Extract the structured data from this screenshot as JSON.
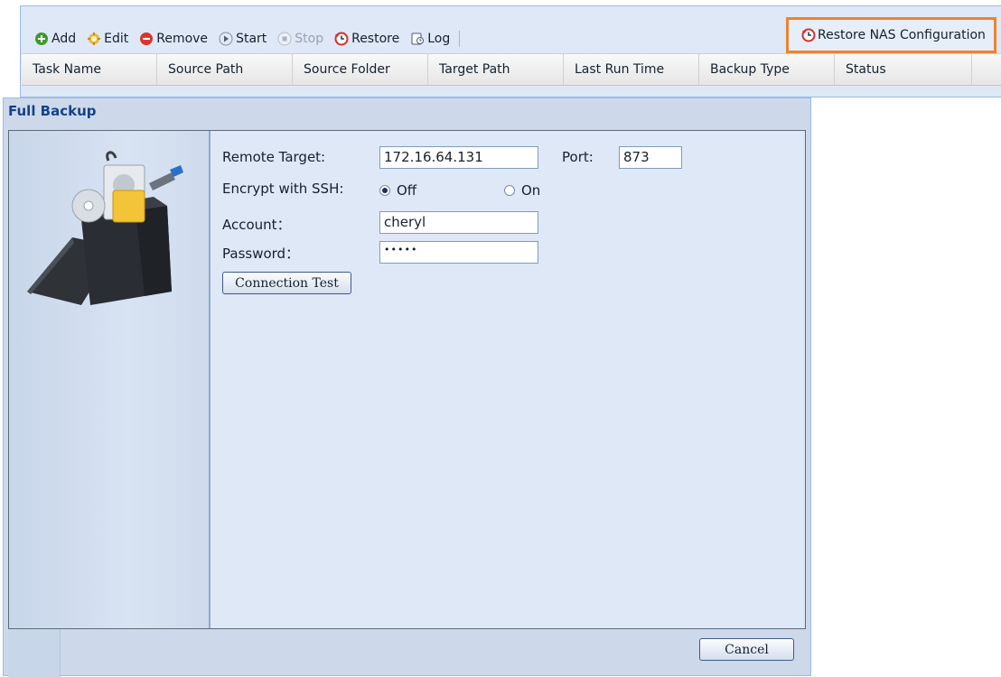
{
  "toolbar": {
    "add": "Add",
    "edit": "Edit",
    "remove": "Remove",
    "start": "Start",
    "stop": "Stop",
    "restore": "Restore",
    "log": "Log",
    "restore_nas": "Restore NAS Configuration"
  },
  "grid": {
    "columns": [
      "Task Name",
      "Source Path",
      "Source Folder",
      "Target Path",
      "Last Run Time",
      "Backup Type",
      "Status"
    ]
  },
  "dialog": {
    "title": "Full Backup",
    "remote_target_label": "Remote Target:",
    "remote_target_value": "172.16.64.131",
    "port_label": "Port:",
    "port_value": "873",
    "encrypt_label": "Encrypt with SSH:",
    "encrypt_off": "Off",
    "encrypt_on": "On",
    "encrypt_selected": "Off",
    "account_label": "Account：",
    "account_value": "cheryl",
    "password_label": "Password：",
    "password_value": "•••••",
    "connection_test": "Connection Test",
    "cancel": "Cancel"
  },
  "colors": {
    "highlight": "#f0822d",
    "panel": "#dfe8f6",
    "title": "#15428b"
  },
  "icons": [
    "add-icon",
    "edit-icon",
    "remove-icon",
    "start-icon",
    "stop-icon",
    "restore-icon",
    "log-icon",
    "backup-box-icon"
  ]
}
